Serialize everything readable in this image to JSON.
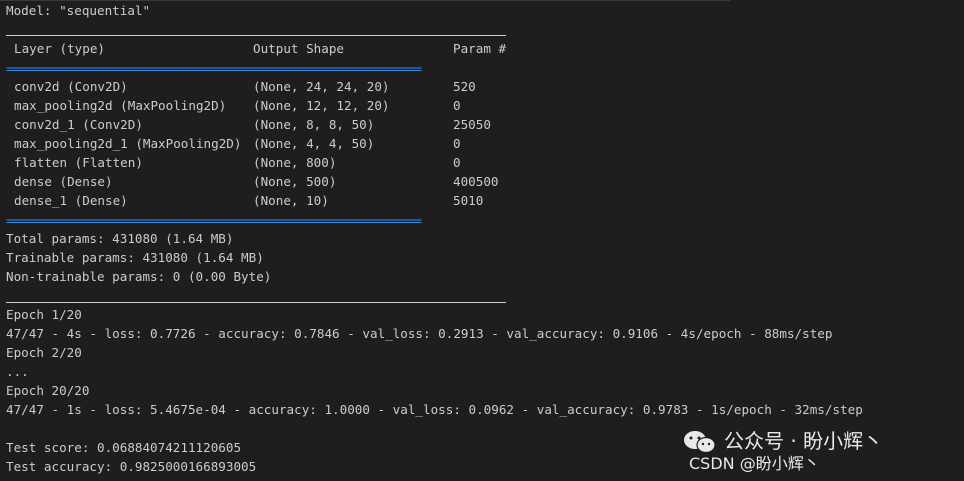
{
  "model_title": "Model: \"sequential\"",
  "table": {
    "headers": [
      "Layer (type)",
      "Output Shape",
      "Param #"
    ],
    "rows": [
      [
        "conv2d (Conv2D)",
        "(None, 24, 24, 20)",
        "520"
      ],
      [
        "max_pooling2d (MaxPooling2D)",
        "(None, 12, 12, 20)",
        "0"
      ],
      [
        "conv2d_1 (Conv2D)",
        "(None, 8, 8, 50)",
        "25050"
      ],
      [
        "max_pooling2d_1 (MaxPooling2D)",
        "(None, 4, 4, 50)",
        "0"
      ],
      [
        "flatten (Flatten)",
        "(None, 800)",
        "0"
      ],
      [
        "dense (Dense)",
        "(None, 500)",
        "400500"
      ],
      [
        "dense_1 (Dense)",
        "(None, 10)",
        "5010"
      ]
    ],
    "separator_text": "================================================================="
  },
  "summary": {
    "total": "Total params: 431080 (1.64 MB)",
    "trainable": "Trainable params: 431080 (1.64 MB)",
    "non_trainable": "Non-trainable params: 0 (0.00 Byte)"
  },
  "training": {
    "epoch1": "Epoch 1/20",
    "epoch1_stats": "47/47 - 4s - loss: 0.7726 - accuracy: 0.7846 - val_loss: 0.2913 - val_accuracy: 0.9106 - 4s/epoch - 88ms/step",
    "epoch2": "Epoch 2/20",
    "ellipsis": "...",
    "epoch20": "Epoch 20/20",
    "epoch20_stats": "47/47 - 1s - loss: 5.4675e-04 - accuracy: 1.0000 - val_loss: 0.0962 - val_accuracy: 0.9783 - 1s/epoch - 32ms/step"
  },
  "test": {
    "score": "Test score: 0.06884074211120605",
    "accuracy": "Test accuracy: 0.9825000166893005"
  },
  "watermark": {
    "title": "公众号 · 盼小辉丶",
    "subtitle": "CSDN @盼小辉丶",
    "icon": "wechat-icon"
  },
  "colors": {
    "background": "#1e1e1e",
    "text": "#cccccc",
    "separator": "#3b8eea"
  }
}
